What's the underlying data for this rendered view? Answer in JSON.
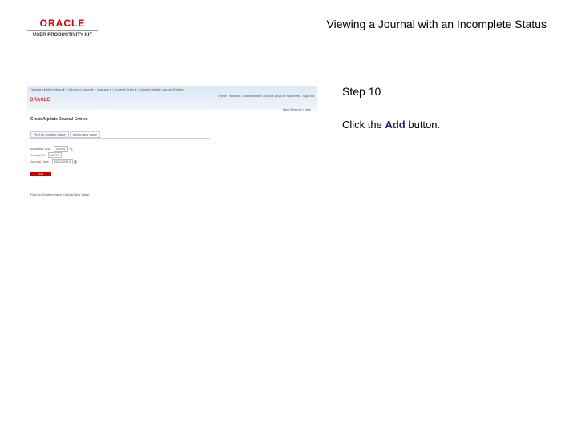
{
  "logo": {
    "brand": "ORACLE",
    "product": "USER PRODUCTIVITY KIT"
  },
  "title": "Viewing a Journal with an Incomplete Status",
  "step": "Step 10",
  "instruction": {
    "pre": "Click the ",
    "bold": "Add",
    "post": " button."
  },
  "screenshot": {
    "breadcrumb": "Favorites ▾  Main Menu ▾ > General Ledger ▾ > Journals ▾ > Journal Entry ▾ > Create/Update Journal Entries",
    "header_links": "Home | Worklist | Multichannel Console | Add to Favorites | Sign out",
    "oracle": "ORACLE",
    "toolbar": "New Window | Help",
    "page_title": "Create/Update Journal Entries",
    "tabs": [
      "Find an Existing Value",
      "Add a New Value"
    ],
    "fields": [
      {
        "label": "Business Unit:",
        "value": "US001"
      },
      {
        "label": "Journal ID:",
        "value": "NEXT"
      },
      {
        "label": "Journal Date:",
        "value": "05/22/2013"
      }
    ],
    "add_button": "Add",
    "footer": "Find an Existing Value | Add a New Value"
  }
}
